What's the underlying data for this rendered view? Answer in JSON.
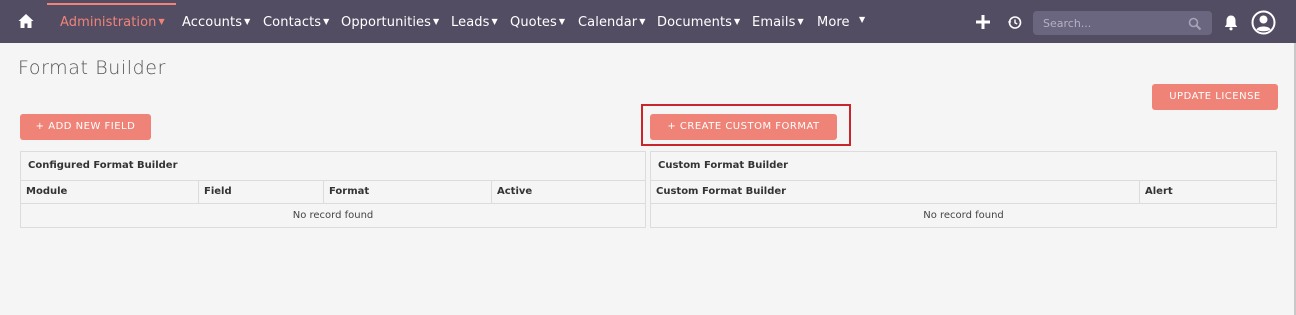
{
  "nav": {
    "home_icon": "home-icon",
    "items": [
      {
        "label": "Administration",
        "active": true
      },
      {
        "label": "Accounts"
      },
      {
        "label": "Contacts"
      },
      {
        "label": "Opportunities"
      },
      {
        "label": "Leads"
      },
      {
        "label": "Quotes"
      },
      {
        "label": "Calendar"
      },
      {
        "label": "Documents"
      },
      {
        "label": "Emails"
      },
      {
        "label": "More"
      }
    ],
    "search_placeholder": "Search...",
    "icons": [
      "plus-icon",
      "history-icon",
      "search-icon",
      "bell-icon",
      "user-avatar-icon"
    ]
  },
  "page": {
    "title": "Format Builder",
    "update_license_label": "UPDATE LICENSE",
    "add_new_field_label": "+ ADD NEW FIELD",
    "create_custom_format_label": "+ CREATE CUSTOM FORMAT"
  },
  "configured_panel": {
    "title": "Configured Format Builder",
    "columns": [
      "Module",
      "Field",
      "Format",
      "Active"
    ],
    "empty_text": "No record found"
  },
  "custom_panel": {
    "title": "Custom Format Builder",
    "columns": [
      "Custom Format Builder",
      "Alert"
    ],
    "empty_text": "No record found"
  },
  "colors": {
    "nav_bg": "#534d64",
    "accent": "#f08377",
    "highlight_border": "#c8262b",
    "page_bg": "#f5f5f5"
  }
}
